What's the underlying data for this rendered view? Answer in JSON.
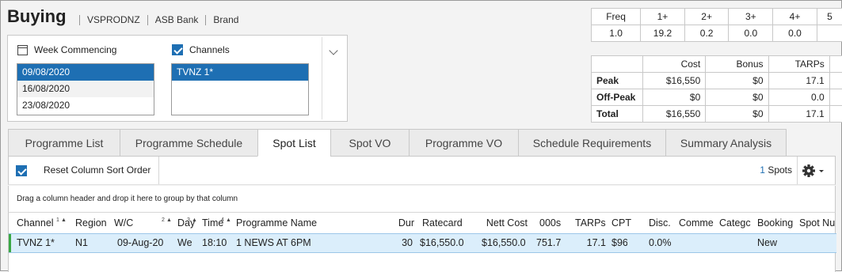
{
  "header": {
    "title": "Buying",
    "crumbs": [
      "VSPRODNZ",
      "ASB Bank",
      "Brand"
    ]
  },
  "filters": {
    "week": {
      "label": "Week Commencing",
      "items": [
        "09/08/2020",
        "16/08/2020",
        "23/08/2020"
      ],
      "selected": "09/08/2020"
    },
    "channels": {
      "label": "Channels",
      "checked": true,
      "items": [
        "TVNZ 1*"
      ],
      "selected": "TVNZ 1*"
    }
  },
  "freq": {
    "headers": [
      "Freq",
      "1+",
      "2+",
      "3+",
      "4+",
      "5"
    ],
    "values": [
      "1.0",
      "19.2",
      "0.2",
      "0.0",
      "0.0",
      ""
    ]
  },
  "summary": {
    "headers": [
      "",
      "Cost",
      "Bonus",
      "TARPs"
    ],
    "rows": [
      {
        "label": "Peak",
        "cost": "$16,550",
        "bonus": "$0",
        "tarps": "17.1"
      },
      {
        "label": "Off-Peak",
        "cost": "$0",
        "bonus": "$0",
        "tarps": "0.0"
      },
      {
        "label": "Total",
        "cost": "$16,550",
        "bonus": "$0",
        "tarps": "17.1"
      }
    ]
  },
  "tabs": [
    "Programme List",
    "Programme Schedule",
    "Spot List",
    "Spot VO",
    "Programme VO",
    "Schedule Requirements",
    "Summary Analysis"
  ],
  "active_tab": "Spot List",
  "toolbar": {
    "reset_label": "Reset Column Sort Order",
    "spot_count": "1",
    "spots_label": "Spots"
  },
  "group_hint": "Drag a column header and drop it here to group by that column",
  "columns": [
    "Channel",
    "Region",
    "W/C",
    "Day",
    "Time",
    "Programme Name",
    "Dur",
    "Ratecard",
    "Nett Cost",
    "000s",
    "TARPs",
    "CPT",
    "Disc.",
    "Comme",
    "Categc",
    "Booking",
    "Spot Nu"
  ],
  "sort_indices": {
    "channel": "1",
    "wc": "2",
    "day": "3",
    "time": "4"
  },
  "rows": [
    {
      "channel": "TVNZ 1*",
      "region": "N1",
      "wc": "09-Aug-20",
      "day": "Wed",
      "time": "18:10",
      "programme": "1 NEWS AT 6PM",
      "dur": "30",
      "ratecard": "$16,550.0",
      "nett_cost": "$16,550.0",
      "thousands": "751.7",
      "tarps": "17.1",
      "cpt": "$96",
      "disc": "0.0%",
      "comment": "",
      "category": "",
      "booking": "New",
      "spot_no": ""
    }
  ],
  "colors": {
    "accent": "#1e6fb3",
    "row_selected": "#dbeefb",
    "row_marker": "#3aa845"
  }
}
